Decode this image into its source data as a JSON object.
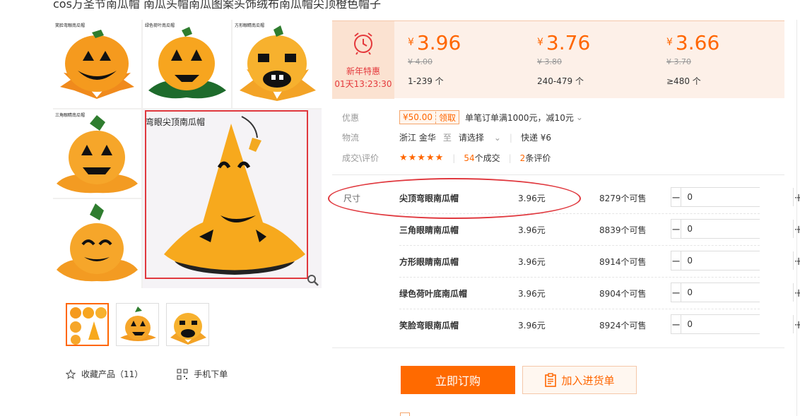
{
  "product": {
    "title": "cos万圣节南瓜帽 南瓜头帽南瓜图案头饰绒布南瓜帽尖顶橙色帽子"
  },
  "gallery": {
    "captions": [
      "笑脸弯眼南瓜帽",
      "绿色荷叶南瓜帽",
      "方形眼睛南瓜帽",
      "三角眼睛南瓜帽",
      "弯眼尖顶南瓜帽"
    ],
    "zoom_icon": "magnifier-icon"
  },
  "actions_below": {
    "favorite_label": "收藏产品（11）",
    "mobile_label": "手机下单",
    "favorite_icon": "star-outline-icon",
    "mobile_icon": "qrcode-icon"
  },
  "promo": {
    "label": "新年特惠",
    "countdown": "01天13:23:30",
    "icon": "alarm-clock-icon"
  },
  "price_tiers": [
    {
      "currency": "¥",
      "price": "3.96",
      "original": "¥ 4.00",
      "range": "1-239 个"
    },
    {
      "currency": "¥",
      "price": "3.76",
      "original": "¥ 3.80",
      "range": "240-479 个"
    },
    {
      "currency": "¥",
      "price": "3.66",
      "original": "¥ 3.70",
      "range": "≥480 个"
    }
  ],
  "info": {
    "discount_label": "优惠",
    "coupon_amount": "¥50.00",
    "coupon_get": "领取",
    "coupon_rule": "单笔订单满1000元，减10元",
    "logistics_label": "物流",
    "origin": "浙江 金华",
    "to": "至",
    "destination_select": "请选择",
    "shipping": "快递 ¥6",
    "deals_label": "成交\\评价",
    "stars": "★★★★★",
    "deals_count": "54",
    "deals_suffix": "个成交",
    "reviews_count": "2",
    "reviews_suffix": "条评价"
  },
  "sku": {
    "label": "尺寸",
    "rows": [
      {
        "name": "尖顶弯眼南瓜帽",
        "price": "3.96元",
        "stock": "8279个可售",
        "qty": "0"
      },
      {
        "name": "三角眼睛南瓜帽",
        "price": "3.96元",
        "stock": "8839个可售",
        "qty": "0"
      },
      {
        "name": "方形眼睛南瓜帽",
        "price": "3.96元",
        "stock": "8914个可售",
        "qty": "0"
      },
      {
        "name": "绿色荷叶底南瓜帽",
        "price": "3.96元",
        "stock": "8904个可售",
        "qty": "0"
      },
      {
        "name": "笑脸弯眼南瓜帽",
        "price": "3.96元",
        "stock": "8924个可售",
        "qty": "0"
      }
    ],
    "minus": "−",
    "plus": "+"
  },
  "buttons": {
    "buy_now": "立即订购",
    "add_to_list": "加入进货单",
    "add_icon": "clipboard-icon"
  },
  "colors": {
    "accent": "#ff6a00",
    "highlight_red": "#e0383e",
    "price_bg": "#fdf0e8"
  }
}
